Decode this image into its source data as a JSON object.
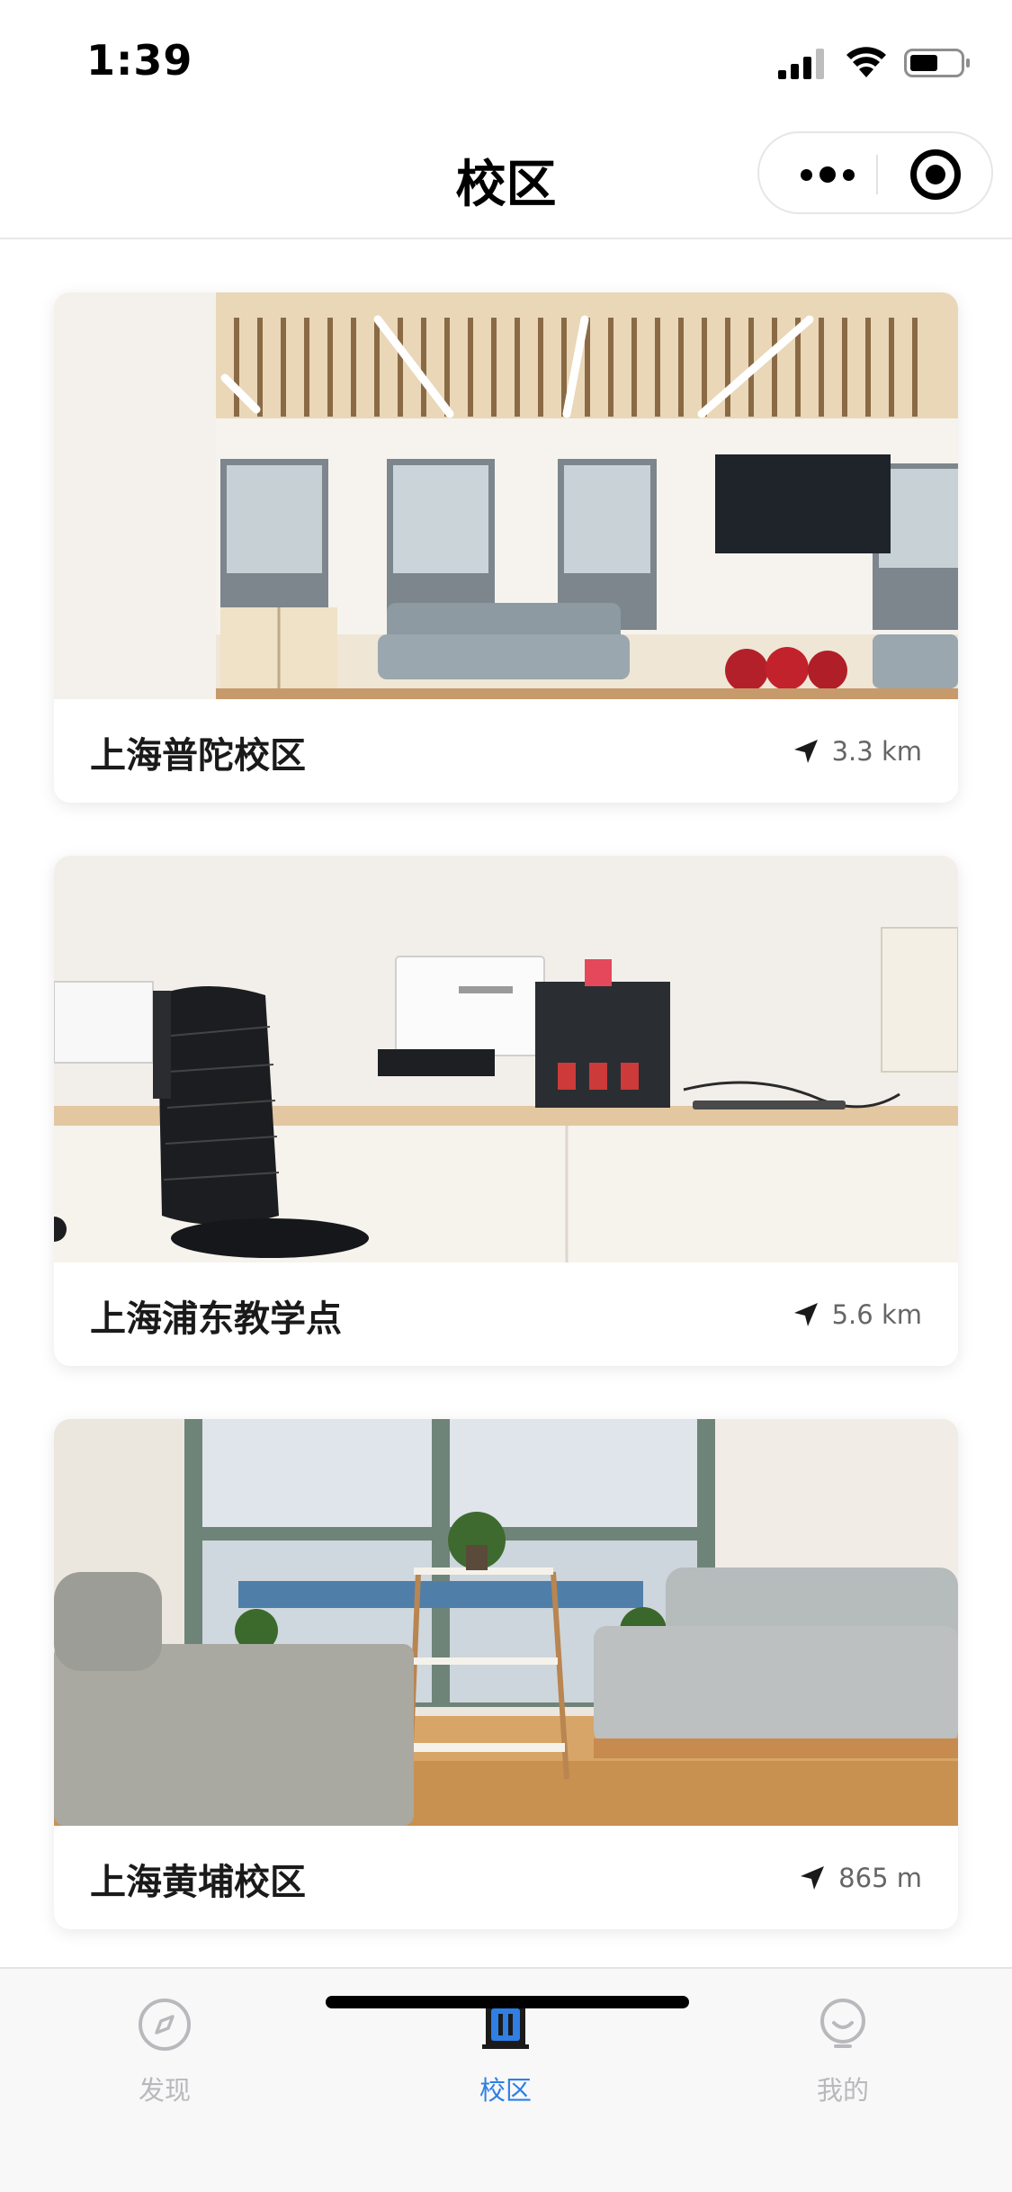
{
  "status_bar": {
    "time": "1:39",
    "icons": [
      "signal-icon",
      "wifi-icon",
      "battery-icon"
    ]
  },
  "nav": {
    "title": "校区",
    "menu_icon": "more-dots-icon",
    "close_icon": "close-circle-icon"
  },
  "campuses": [
    {
      "name": "上海普陀校区",
      "distance": "3.3 km",
      "icon": "location-arrow-icon"
    },
    {
      "name": "上海浦东教学点",
      "distance": "5.6 km",
      "icon": "location-arrow-icon"
    },
    {
      "name": "上海黄埔校区",
      "distance": "865 m",
      "icon": "location-arrow-icon"
    }
  ],
  "tabs": [
    {
      "label": "发现",
      "icon": "compass-icon",
      "active": false
    },
    {
      "label": "校区",
      "icon": "campus-building-icon",
      "active": true
    },
    {
      "label": "我的",
      "icon": "smiley-user-icon",
      "active": false
    }
  ],
  "colors": {
    "accent": "#2f7fe5",
    "tab_inactive": "#b9b9bd",
    "text_primary": "#1a1a1a",
    "text_secondary": "#666666"
  }
}
